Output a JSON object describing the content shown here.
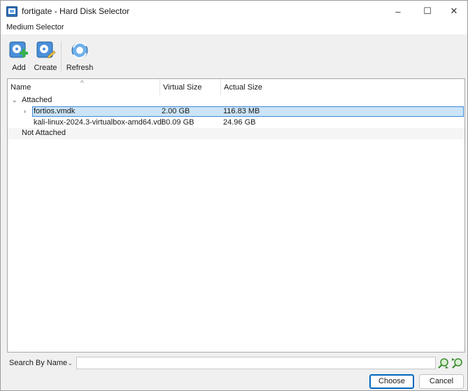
{
  "window": {
    "title": "fortigate - Hard Disk Selector",
    "controls": {
      "minimize": "–",
      "maximize": "☐",
      "close": "✕"
    }
  },
  "menu_label": "Medium Selector",
  "toolbar": {
    "add_label": "Add",
    "create_label": "Create",
    "refresh_label": "Refresh"
  },
  "tree": {
    "columns": {
      "name": "Name",
      "virtual_size": "Virtual Size",
      "actual_size": "Actual Size"
    },
    "groups": [
      {
        "label": "Attached",
        "items": [
          {
            "name": "fortios.vmdk",
            "virtual_size": "2.00 GB",
            "actual_size": "116.83 MB",
            "selected": true
          },
          {
            "name": "kali-linux-2024.3-virtualbox-amd64.vdi",
            "virtual_size": "80.09 GB",
            "actual_size": "24.96 GB",
            "selected": false
          }
        ]
      },
      {
        "label": "Not Attached",
        "items": []
      }
    ]
  },
  "search": {
    "mode": "Search By Name",
    "value": ""
  },
  "buttons": {
    "choose": "Choose",
    "cancel": "Cancel"
  },
  "colors": {
    "selection_fill": "#cce4f7",
    "selection_border": "#3f8ad8",
    "default_button_border": "#0067c0"
  }
}
